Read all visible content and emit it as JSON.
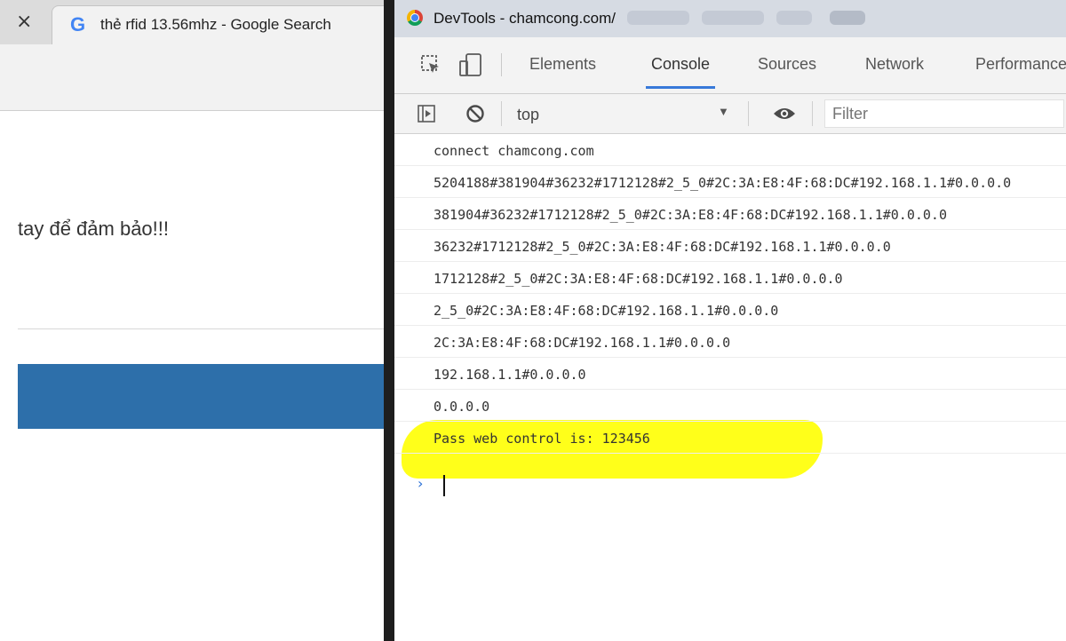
{
  "browser": {
    "tab_close_glyph": "×",
    "tab_icon": "G",
    "tab_title": "thẻ rfid 13.56mhz - Google Search",
    "page_text": "tay để đảm bảo!!!"
  },
  "devtools": {
    "window_title": "DevTools - chamcong.com/",
    "tabs": [
      "Elements",
      "Console",
      "Sources",
      "Network",
      "Performance"
    ],
    "active_tab": "Console",
    "context": "top",
    "filter_placeholder": "Filter",
    "console_lines": [
      "connect chamcong.com",
      "5204188#381904#36232#1712128#2_5_0#2C:3A:E8:4F:68:DC#192.168.1.1#0.0.0.0",
      "381904#36232#1712128#2_5_0#2C:3A:E8:4F:68:DC#192.168.1.1#0.0.0.0",
      "36232#1712128#2_5_0#2C:3A:E8:4F:68:DC#192.168.1.1#0.0.0.0",
      "1712128#2_5_0#2C:3A:E8:4F:68:DC#192.168.1.1#0.0.0.0",
      "2_5_0#2C:3A:E8:4F:68:DC#192.168.1.1#0.0.0.0",
      "2C:3A:E8:4F:68:DC#192.168.1.1#0.0.0.0",
      "192.168.1.1#0.0.0.0",
      "0.0.0.0",
      "Pass web control is: 123456"
    ],
    "prompt_glyph": "›"
  },
  "colors": {
    "highlight": "#ffff1a",
    "active_tab_underline": "#3879d9",
    "page_blue_bar": "#2d6faa"
  },
  "icons": [
    "inspect-element-icon",
    "device-toolbar-icon",
    "sidebar-toggle-icon",
    "clear-console-icon",
    "eye-icon",
    "chrome-icon",
    "google-icon"
  ]
}
